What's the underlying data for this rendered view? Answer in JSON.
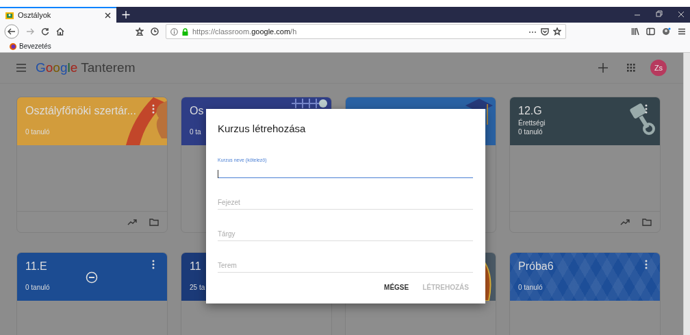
{
  "browser": {
    "tab": {
      "title": "Osztályok"
    },
    "url": {
      "prefix": "https://classroom.",
      "domain": "google.com",
      "path": "/h"
    },
    "bookmarks": [
      {
        "label": "Bevezetés"
      }
    ]
  },
  "app": {
    "brand": {
      "google": "Google",
      "name": "Tanterem"
    },
    "avatar": "Zs"
  },
  "cards": [
    {
      "title": "Osztályfőnöki szertár...",
      "students": "0 tanuló",
      "color": "#d29c3c",
      "kind": "swoosh",
      "footer": true,
      "menu": true
    },
    {
      "title": "Os",
      "students": "0 ta",
      "color": "#2e3d86",
      "kind": "grid",
      "footer": false,
      "menu": false
    },
    {
      "color": "#2a62a4",
      "kind": "cap",
      "footer": false,
      "menu": false
    },
    {
      "title": "12.G",
      "subtitle": "Érettségi",
      "students": "0 tanuló",
      "color": "#33434b",
      "kind": "piston",
      "footer": true,
      "menu": true
    },
    {
      "title": "11.E",
      "students": "0 tanuló",
      "color": "#1c4c92",
      "kind": "blocked",
      "footer": false,
      "menu": true
    },
    {
      "title": "11",
      "students": "25 ta",
      "color": "#1b3a78",
      "kind": "plain"
    },
    {
      "color": "#4b5a66",
      "kind": "bird"
    },
    {
      "title": "Próba6",
      "students": "0 tanuló",
      "color": "#1d4e98",
      "kind": "pattern",
      "footer": false,
      "menu": true
    }
  ],
  "dialog": {
    "title": "Kurzus létrehozása",
    "fields": [
      {
        "label": "Kurzus neve (kötelező)",
        "focused": true
      },
      {
        "placeholder": "Fejezet",
        "focused": false
      },
      {
        "placeholder": "Tárgy",
        "focused": false
      },
      {
        "placeholder": "Terem",
        "focused": false
      }
    ],
    "buttons": [
      {
        "label": "MÉGSE",
        "disabled": false
      },
      {
        "label": "LÉTREHOZÁS",
        "disabled": true
      }
    ]
  }
}
